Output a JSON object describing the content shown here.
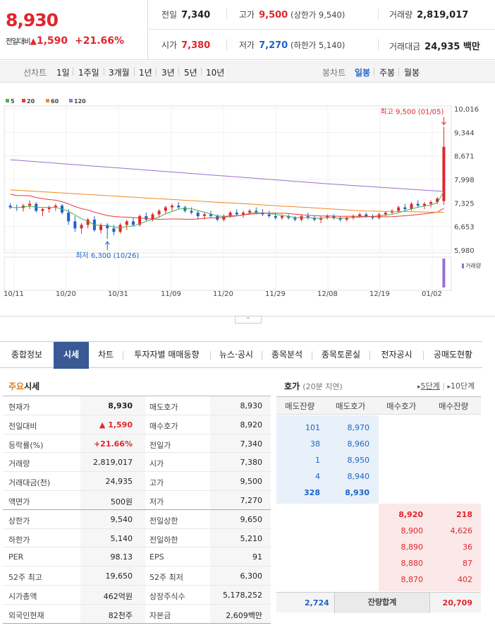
{
  "quote": {
    "price": "8,930",
    "change_label": "전일대비",
    "change_arrow": "▲",
    "change": "1,590",
    "change_pct": "+21.66%"
  },
  "summary": {
    "prev_close_label": "전일",
    "prev_close": "7,340",
    "high_label": "고가",
    "high": "9,500",
    "upper_limit": "(상한가 9,540)",
    "volume_label": "거래량",
    "volume": "2,819,017",
    "open_label": "시가",
    "open": "7,380",
    "low_label": "저가",
    "low": "7,270",
    "lower_limit": "(하한가 5,140)",
    "value_label": "거래대금",
    "value": "24,935 백만"
  },
  "chart_tabs": {
    "line_label": "선차트",
    "periods": [
      "1일",
      "1주일",
      "3개월",
      "1년",
      "3년",
      "5년",
      "10년"
    ],
    "candle_label": "봉차트",
    "candles": [
      "일봉",
      "주봉",
      "월봉"
    ],
    "selected_candle": "일봉"
  },
  "chart_data": {
    "type": "candlestick",
    "legend": [
      {
        "name": "5",
        "color": "#4caf50"
      },
      {
        "name": "20",
        "color": "#e53935"
      },
      {
        "name": "60",
        "color": "#f08a24"
      },
      {
        "name": "120",
        "color": "#9c6fd0"
      }
    ],
    "y_ticks": [
      "10,016",
      "9,344",
      "8,671",
      "7,998",
      "7,325",
      "6,653",
      "5,980"
    ],
    "ylim": [
      5980,
      10016
    ],
    "x_ticks": [
      "10/11",
      "10/20",
      "10/31",
      "11/09",
      "11/20",
      "11/29",
      "12/08",
      "12/19",
      "01/02"
    ],
    "max_annotation": "최고 9,500 (01/05)",
    "min_annotation": "최저 6,300 (10/26)",
    "volume_label": "거래량",
    "candles": [
      [
        7250,
        7320,
        7150,
        7200
      ],
      [
        7200,
        7280,
        7100,
        7180
      ],
      [
        7180,
        7300,
        7080,
        7250
      ],
      [
        7250,
        7400,
        7150,
        7300
      ],
      [
        7300,
        7350,
        7050,
        7100
      ],
      [
        7100,
        7200,
        6950,
        7150
      ],
      [
        7150,
        7250,
        7050,
        7200
      ],
      [
        7200,
        7300,
        7100,
        7250
      ],
      [
        7250,
        7300,
        7000,
        7050
      ],
      [
        7050,
        7150,
        6700,
        6800
      ],
      [
        6800,
        6950,
        6500,
        6600
      ],
      [
        6600,
        6750,
        6450,
        6700
      ],
      [
        6700,
        6900,
        6600,
        6850
      ],
      [
        6850,
        6950,
        6500,
        6550
      ],
      [
        6550,
        6750,
        6450,
        6700
      ],
      [
        6700,
        6750,
        6300,
        6600
      ],
      [
        6600,
        6700,
        6400,
        6500
      ],
      [
        6500,
        6750,
        6450,
        6700
      ],
      [
        6700,
        6850,
        6550,
        6800
      ],
      [
        6800,
        6900,
        6650,
        6700
      ],
      [
        6700,
        7000,
        6650,
        6950
      ],
      [
        6950,
        7050,
        6800,
        6850
      ],
      [
        6850,
        7050,
        6800,
        7000
      ],
      [
        7000,
        7150,
        6900,
        7100
      ],
      [
        7100,
        7250,
        7000,
        7200
      ],
      [
        7200,
        7300,
        7100,
        7250
      ],
      [
        7250,
        7350,
        7150,
        7200
      ],
      [
        7200,
        7250,
        7050,
        7100
      ],
      [
        7100,
        7200,
        7000,
        7050
      ],
      [
        7050,
        7100,
        6850,
        6950
      ],
      [
        6950,
        7050,
        6850,
        7000
      ],
      [
        7000,
        7100,
        6900,
        6950
      ],
      [
        6950,
        7000,
        6800,
        6850
      ],
      [
        6850,
        7000,
        6800,
        6950
      ],
      [
        6950,
        7100,
        6900,
        7050
      ],
      [
        7050,
        7150,
        6950,
        7000
      ],
      [
        7000,
        7100,
        6900,
        7050
      ],
      [
        7050,
        7150,
        7000,
        7100
      ],
      [
        7100,
        7200,
        7000,
        7050
      ],
      [
        7050,
        7150,
        6950,
        7000
      ],
      [
        7000,
        7100,
        6900,
        6950
      ],
      [
        6950,
        7050,
        6850,
        6900
      ],
      [
        6900,
        7000,
        6850,
        6950
      ],
      [
        6950,
        7000,
        6850,
        6900
      ],
      [
        6900,
        6950,
        6800,
        6850
      ],
      [
        6850,
        7000,
        6800,
        6950
      ],
      [
        6950,
        7050,
        6850,
        6900
      ],
      [
        6900,
        6950,
        6800,
        6850
      ],
      [
        6850,
        6950,
        6750,
        6900
      ],
      [
        6900,
        7000,
        6850,
        6950
      ],
      [
        6950,
        7000,
        6850,
        6900
      ],
      [
        6900,
        6950,
        6800,
        6850
      ],
      [
        6850,
        6950,
        6800,
        6900
      ],
      [
        6900,
        7000,
        6850,
        6950
      ],
      [
        6950,
        7050,
        6900,
        7000
      ],
      [
        7000,
        7050,
        6900,
        6950
      ],
      [
        6950,
        7000,
        6850,
        6900
      ],
      [
        6900,
        7050,
        6850,
        7000
      ],
      [
        7000,
        7100,
        6950,
        7050
      ],
      [
        7050,
        7150,
        7000,
        7100
      ],
      [
        7100,
        7250,
        7050,
        7200
      ],
      [
        7200,
        7300,
        7100,
        7150
      ],
      [
        7150,
        7350,
        7100,
        7300
      ],
      [
        7300,
        7400,
        7200,
        7250
      ],
      [
        7250,
        7350,
        7150,
        7300
      ],
      [
        7300,
        7400,
        7200,
        7350
      ],
      [
        7350,
        7500,
        7300,
        7450
      ],
      [
        7380,
        9500,
        7270,
        8930
      ]
    ]
  },
  "nav": {
    "items": [
      "종합정보",
      "시세",
      "차트",
      "투자자별 매매동향",
      "뉴스·공시",
      "종목분석",
      "종목토론실",
      "전자공시",
      "공매도현황"
    ],
    "selected": "시세"
  },
  "main": {
    "title_accent": "주요",
    "title_rest": "시세",
    "rows": [
      {
        "k1": "현재가",
        "v1": "8,930",
        "k2": "매도호가",
        "v2": "8,930"
      },
      {
        "k1": "전일대비",
        "v1": "▲ 1,590",
        "k2": "매수호가",
        "v2": "8,920"
      },
      {
        "k1": "등락률(%)",
        "v1": "+21.66%",
        "k2": "전일가",
        "v2": "7,340"
      },
      {
        "k1": "거래량",
        "v1": "2,819,017",
        "k2": "시가",
        "v2": "7,380"
      },
      {
        "k1": "거래대금(천)",
        "v1": "24,935",
        "k2": "고가",
        "v2": "9,500"
      },
      {
        "k1": "액면가",
        "v1": "500원",
        "k2": "저가",
        "v2": "7,270"
      },
      {
        "k1": "상한가",
        "v1": "9,540",
        "k2": "전일상한",
        "v2": "9,650"
      },
      {
        "k1": "하한가",
        "v1": "5,140",
        "k2": "전일하한",
        "v2": "5,210"
      },
      {
        "k1": "PER",
        "v1": "98.13",
        "k2": "EPS",
        "v2": "91"
      },
      {
        "k1": "52주 최고",
        "v1": "19,650",
        "k2": "52주 최저",
        "v2": "6,300"
      },
      {
        "k1": "시가총액",
        "v1": "462억원",
        "k2": "상장주식수",
        "v2": "5,178,252"
      },
      {
        "k1": "외국인현재",
        "v1": "82천주",
        "k2": "자본금",
        "v2": "2,609백만"
      }
    ]
  },
  "orderbook": {
    "title": "호가",
    "delay": "(20분 지연)",
    "opt_5": "5단계",
    "opt_10": "10단계",
    "headers": [
      "매도잔량",
      "매도호가",
      "매수호가",
      "매수잔량"
    ],
    "asks": [
      {
        "qty": "101",
        "price": "8,970"
      },
      {
        "qty": "38",
        "price": "8,960"
      },
      {
        "qty": "1",
        "price": "8,950"
      },
      {
        "qty": "4",
        "price": "8,940"
      },
      {
        "qty": "328",
        "price": "8,930"
      }
    ],
    "bids": [
      {
        "price": "8,920",
        "qty": "218"
      },
      {
        "price": "8,900",
        "qty": "4,626"
      },
      {
        "price": "8,890",
        "qty": "36"
      },
      {
        "price": "8,880",
        "qty": "87"
      },
      {
        "price": "8,870",
        "qty": "402"
      }
    ],
    "total_ask": "2,724",
    "total_label": "잔량합계",
    "total_bid": "20,709"
  }
}
